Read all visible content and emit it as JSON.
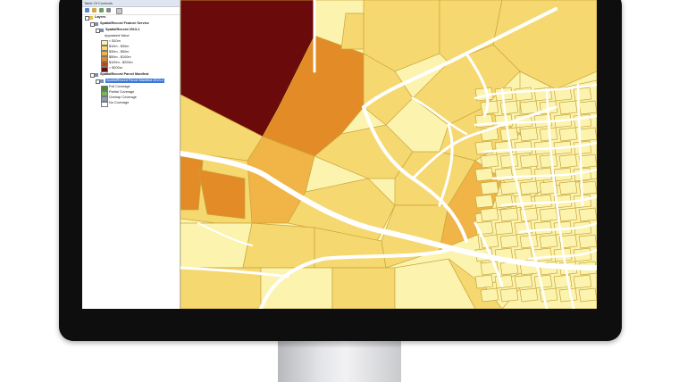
{
  "toc": {
    "title": "Table Of Contents",
    "items": [
      {
        "label": "Layers",
        "indent": 0,
        "kind": "group"
      },
      {
        "label": "SpatialRecord Feature Service",
        "indent": 1,
        "kind": "layer"
      },
      {
        "label": "SpatialRecord 2013-1",
        "indent": 2,
        "kind": "layer"
      },
      {
        "label": "Appraised Value",
        "indent": 3,
        "kind": "text"
      },
      {
        "label": "< $10m",
        "indent": 3,
        "kind": "legend",
        "color": "#fbf3ae"
      },
      {
        "label": "$10m - $30m",
        "indent": 3,
        "kind": "legend",
        "color": "#f6d870"
      },
      {
        "label": "$30m - $50m",
        "indent": 3,
        "kind": "legend",
        "color": "#f0b447"
      },
      {
        "label": "$50m - $100m",
        "indent": 3,
        "kind": "legend",
        "color": "#e38b27"
      },
      {
        "label": "$100m - $200m",
        "indent": 3,
        "kind": "legend",
        "color": "#b84a12"
      },
      {
        "label": "> $200m",
        "indent": 3,
        "kind": "legend",
        "color": "#6b0a0a"
      },
      {
        "label": "SpatialRecord Parcel Manifest",
        "indent": 1,
        "kind": "layer"
      },
      {
        "label": "SpatialRecord Parcel Manifest 2013-1",
        "indent": 2,
        "kind": "selected"
      },
      {
        "label": "Full Coverage",
        "indent": 3,
        "kind": "legend",
        "color": "#3f8f2c"
      },
      {
        "label": "Partial Coverage",
        "indent": 3,
        "kind": "legend",
        "color": "#7fb35a"
      },
      {
        "label": "Overlap Coverage",
        "indent": 3,
        "kind": "legend",
        "color": "#8aa0b8"
      },
      {
        "label": "No Coverage",
        "indent": 3,
        "kind": "legend",
        "color": "#ffffff"
      }
    ]
  },
  "map": {
    "parcel_colors": {
      "lightest": "#fbf3ae",
      "light": "#f6d870",
      "medium": "#f0b447",
      "dark": "#e38b27",
      "darkest": "#6b0a0a",
      "road": "#ffffff",
      "outline": "#c9a53a"
    }
  }
}
